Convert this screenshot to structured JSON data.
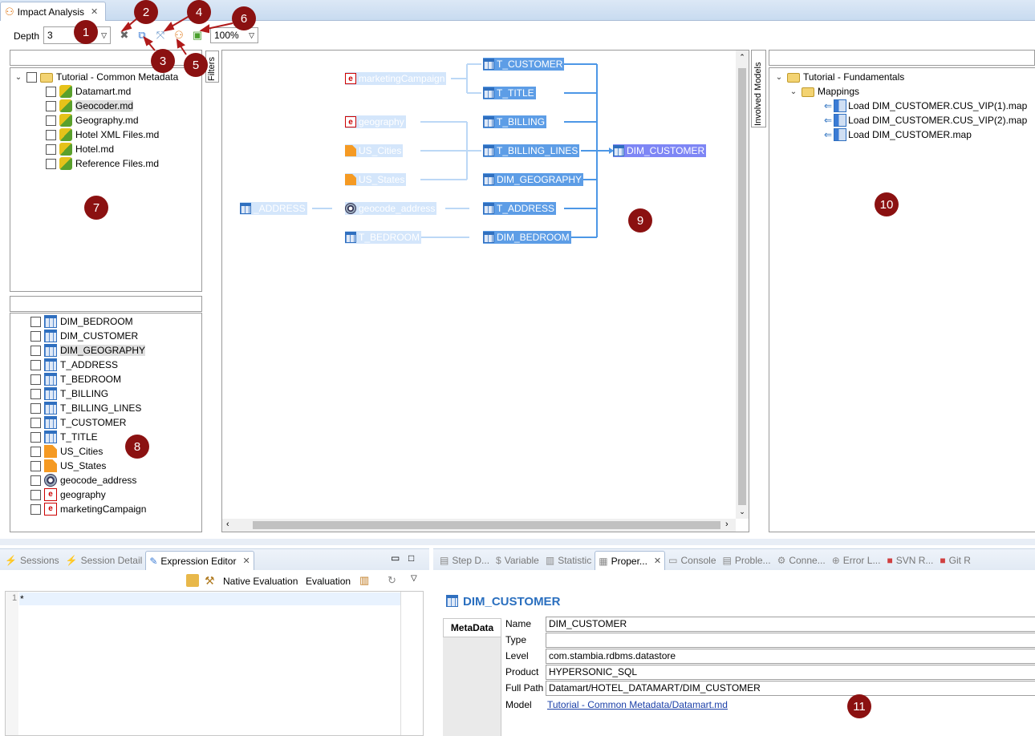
{
  "tab": {
    "title": "Impact Analysis"
  },
  "toolbar": {
    "depth_label": "Depth",
    "depth_value": "3",
    "zoom_value": "100%"
  },
  "markers": [
    "1",
    "2",
    "3",
    "4",
    "5",
    "6",
    "7",
    "8",
    "9",
    "10",
    "11"
  ],
  "filters_tab": "Filters",
  "involved_models_tab": "Involved Models",
  "models_tree": {
    "root": "Tutorial - Common Metadata",
    "items": [
      "Datamart.md",
      "Geocoder.md",
      "Geography.md",
      "Hotel XML Files.md",
      "Hotel.md",
      "Reference Files.md"
    ]
  },
  "objects_list": [
    {
      "label": "DIM_BEDROOM",
      "icon": "table-icon"
    },
    {
      "label": "DIM_CUSTOMER",
      "icon": "table-icon"
    },
    {
      "label": "DIM_GEOGRAPHY",
      "icon": "table-icon"
    },
    {
      "label": "T_ADDRESS",
      "icon": "table-icon"
    },
    {
      "label": "T_BEDROOM",
      "icon": "table-icon"
    },
    {
      "label": "T_BILLING",
      "icon": "table-icon"
    },
    {
      "label": "T_BILLING_LINES",
      "icon": "table-icon"
    },
    {
      "label": "T_CUSTOMER",
      "icon": "table-icon"
    },
    {
      "label": "T_TITLE",
      "icon": "table-icon"
    },
    {
      "label": "US_Cities",
      "icon": "file-icon"
    },
    {
      "label": "US_States",
      "icon": "file-icon"
    },
    {
      "label": "geocode_address",
      "icon": "webservice-icon"
    },
    {
      "label": "geography",
      "icon": "xml-element-icon"
    },
    {
      "label": "marketingCampaign",
      "icon": "xml-element-icon"
    }
  ],
  "diagram": {
    "col1": [
      {
        "label": "_ADDRESS",
        "icon": "table-icon"
      }
    ],
    "col2": [
      {
        "label": "marketingCampaign",
        "icon": "xml-element-icon"
      },
      {
        "label": "geography",
        "icon": "xml-element-icon"
      },
      {
        "label": "US_Cities",
        "icon": "file-icon"
      },
      {
        "label": "US_States",
        "icon": "file-icon"
      },
      {
        "label": "geocode_address",
        "icon": "webservice-icon"
      },
      {
        "label": "T_BEDROOM",
        "icon": "table-icon"
      }
    ],
    "col3": [
      {
        "label": "T_CUSTOMER",
        "icon": "table-icon"
      },
      {
        "label": "T_TITLE",
        "icon": "table-icon"
      },
      {
        "label": "T_BILLING",
        "icon": "table-icon"
      },
      {
        "label": "T_BILLING_LINES",
        "icon": "table-icon"
      },
      {
        "label": "DIM_GEOGRAPHY",
        "icon": "table-icon"
      },
      {
        "label": "T_ADDRESS",
        "icon": "table-icon"
      },
      {
        "label": "DIM_BEDROOM",
        "icon": "table-icon"
      }
    ],
    "target": {
      "label": "DIM_CUSTOMER",
      "icon": "table-icon"
    }
  },
  "involved_models": {
    "root": "Tutorial - Fundamentals",
    "folder": "Mappings",
    "items": [
      "Load DIM_CUSTOMER.CUS_VIP(1).map",
      "Load DIM_CUSTOMER.CUS_VIP(2).map",
      "Load DIM_CUSTOMER.map"
    ]
  },
  "bottom_left": {
    "tabs": [
      "Sessions",
      "Session Detail",
      "Expression Editor"
    ],
    "native_eval": "Native Evaluation",
    "evaluation": "Evaluation",
    "line_no": "1",
    "editor_text": "*"
  },
  "bottom_right": {
    "tabs": [
      "Step D...",
      "Variable",
      "Statistic",
      "Proper...",
      "Console",
      "Proble...",
      "Conne...",
      "Error L...",
      "SVN R...",
      "Git R"
    ],
    "title": "DIM_CUSTOMER",
    "side_tab": "MetaData",
    "properties": [
      {
        "label": "Name",
        "value": "DIM_CUSTOMER"
      },
      {
        "label": "Type",
        "value": ""
      },
      {
        "label": "Level",
        "value": "com.stambia.rdbms.datastore"
      },
      {
        "label": "Product",
        "value": "HYPERSONIC_SQL"
      },
      {
        "label": "Full Path",
        "value": "Datamart/HOTEL_DATAMART/DIM_CUSTOMER"
      }
    ],
    "model_label": "Model",
    "model_link": "Tutorial - Common Metadata/Datamart.md"
  }
}
